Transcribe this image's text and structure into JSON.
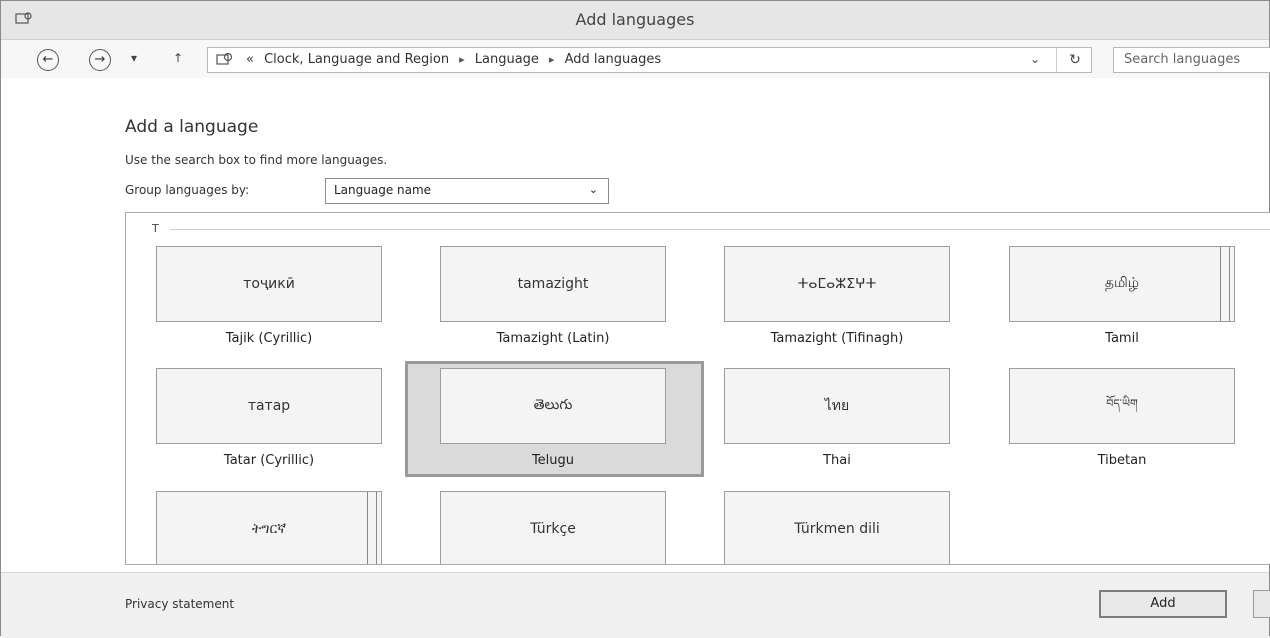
{
  "window": {
    "title": "Add languages"
  },
  "nav": {
    "back": "←",
    "forward": "→",
    "recent": "▾",
    "up": "↑"
  },
  "address": {
    "overflow": "«",
    "crumbs": [
      "Clock, Language and Region",
      "Language",
      "Add languages"
    ],
    "separator": "▸",
    "dropdown": "⌄",
    "refresh": "↻"
  },
  "search": {
    "placeholder": "Search languages"
  },
  "main": {
    "heading": "Add a language",
    "hint": "Use the search box to find more languages.",
    "group_label": "Group languages by:",
    "group_value": "Language name",
    "group_arrow": "⌄"
  },
  "list": {
    "group_letter": "T",
    "tiles": [
      {
        "native": "тоҷикӣ",
        "label": "Tajik (Cyrillic)"
      },
      {
        "native": "tamazight",
        "label": "Tamazight (Latin)"
      },
      {
        "native": "ⵜⴰⵎⴰⵣⵉⵖⵜ",
        "label": "Tamazight (Tifinagh)"
      },
      {
        "native": "தமிழ்",
        "label": "Tamil"
      },
      {
        "native": "татар",
        "label": "Tatar (Cyrillic)"
      },
      {
        "native": "తెలుగు",
        "label": "Telugu"
      },
      {
        "native": "ไทย",
        "label": "Thai"
      },
      {
        "native": "བོད་ཡིག",
        "label": "Tibetan"
      },
      {
        "native": "ትግርኛ",
        "label": ""
      },
      {
        "native": "Türkçe",
        "label": ""
      },
      {
        "native": "Türkmen dili",
        "label": ""
      }
    ]
  },
  "footer": {
    "privacy": "Privacy statement",
    "add_button": "Add"
  },
  "colors": {
    "selection": "#dadada",
    "tile_bg": "#f4f4f4",
    "border": "#9d9d9d"
  }
}
